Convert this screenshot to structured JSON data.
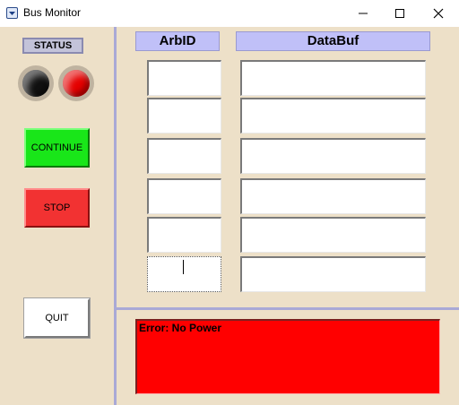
{
  "window": {
    "title": "Bus Monitor",
    "minimize_glyph": "minimize-icon",
    "maximize_glyph": "maximize-icon",
    "close_glyph": "close-icon"
  },
  "status_panel": {
    "label": "STATUS",
    "indicators": [
      {
        "name": "led-left",
        "color": "#111111"
      },
      {
        "name": "led-right",
        "color": "#e50000"
      }
    ]
  },
  "buttons": {
    "continue": "CONTINUE",
    "stop": "STOP",
    "quit": "QUIT"
  },
  "table": {
    "headers": [
      "ArbID",
      "DataBuf"
    ],
    "rows": [
      {
        "arbid": "",
        "databuf": ""
      },
      {
        "arbid": "",
        "databuf": ""
      },
      {
        "arbid": "",
        "databuf": ""
      },
      {
        "arbid": "",
        "databuf": ""
      },
      {
        "arbid": "",
        "databuf": ""
      },
      {
        "arbid": "",
        "databuf": ""
      }
    ]
  },
  "error": {
    "message": "Error: No Power",
    "background": "#ff0000"
  },
  "colors": {
    "client_bg": "#ede0c8",
    "header_bg": "#c0c0f8",
    "separator": "#a9a9d6",
    "continue_bg": "#19e619",
    "stop_bg": "#f23232"
  }
}
